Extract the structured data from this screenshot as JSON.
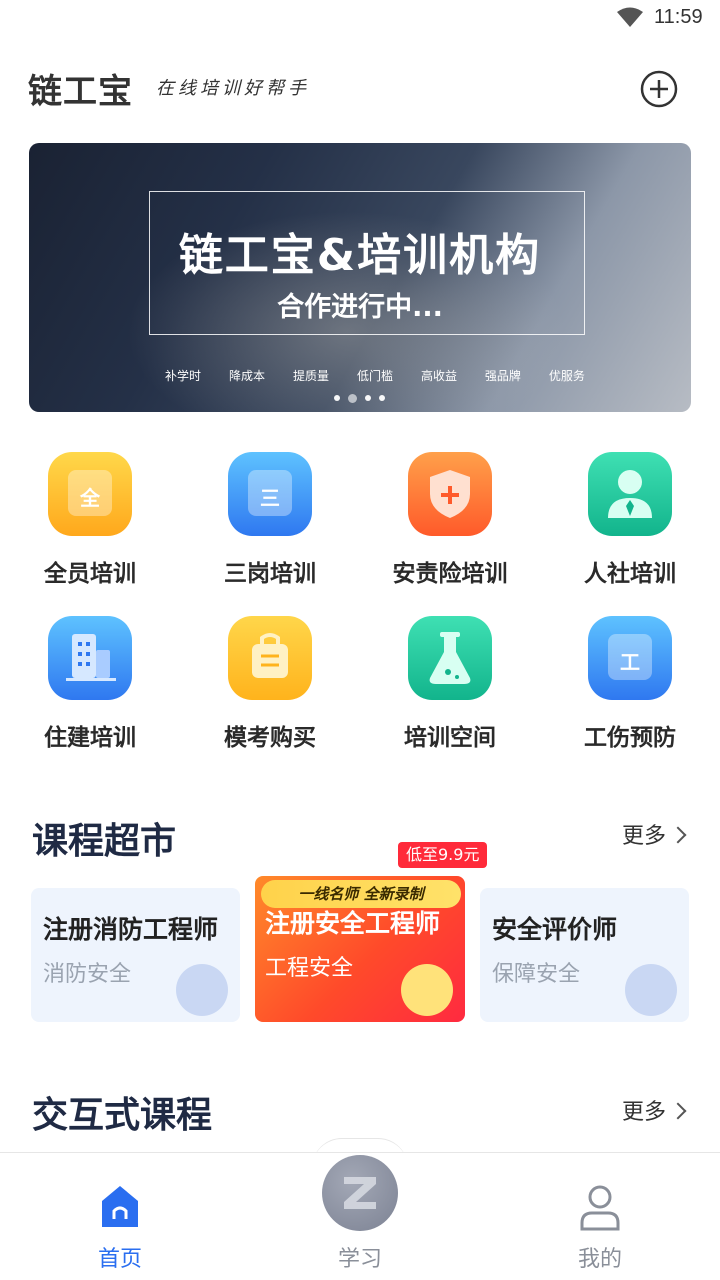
{
  "status_bar": {
    "time": "11:59"
  },
  "header": {
    "logo": "链工宝",
    "slogan": "在线培训好帮手"
  },
  "banner": {
    "title": "链工宝&培训机构",
    "subtitle": "合作进行中...",
    "tags": [
      "补学时",
      "降成本",
      "提质量",
      "低门槛",
      "高收益",
      "强品牌",
      "优服务"
    ],
    "page_count": 4,
    "active_page": 2
  },
  "categories": [
    {
      "label": "全员培训",
      "glyph": "全",
      "icon": "document-icon",
      "color": "#ffb31c"
    },
    {
      "label": "三岗培训",
      "glyph": "三",
      "icon": "document-icon",
      "color": "#2f78f0"
    },
    {
      "label": "安责险培训",
      "glyph": "+",
      "icon": "shield-plus-icon",
      "color": "#ff5a2a"
    },
    {
      "label": "人社培训",
      "glyph": "",
      "icon": "person-tie-icon",
      "color": "#12b48c"
    },
    {
      "label": "住建培训",
      "glyph": "",
      "icon": "building-icon",
      "color": "#2f78f0"
    },
    {
      "label": "模考购买",
      "glyph": "",
      "icon": "shopping-bag-icon",
      "color": "#ffb31c"
    },
    {
      "label": "培训空间",
      "glyph": "",
      "icon": "flask-icon",
      "color": "#12b48c"
    },
    {
      "label": "工伤预防",
      "glyph": "工",
      "icon": "document-icon",
      "color": "#2f78f0"
    }
  ],
  "course_market": {
    "title": "课程超市",
    "more": "更多",
    "courses": [
      {
        "title": "注册消防工程师",
        "subtitle": "消防安全",
        "icon": "fire-extinguisher-icon"
      },
      {
        "title": "注册安全工程师",
        "subtitle": "工程安全",
        "icon": "person-badge-icon",
        "ribbon": "一线名师 全新录制",
        "price_badge": "低至9.9元"
      },
      {
        "title": "安全评价师",
        "subtitle": "保障安全",
        "icon": "clipboard-icon"
      }
    ]
  },
  "interactive_courses": {
    "title": "交互式课程",
    "more": "更多"
  },
  "bottom_nav": {
    "items": [
      {
        "label": "首页",
        "icon": "home-icon",
        "active": true
      },
      {
        "label": "学习",
        "icon": "study-icon",
        "active": false
      },
      {
        "label": "我的",
        "icon": "user-icon",
        "active": false
      }
    ]
  }
}
